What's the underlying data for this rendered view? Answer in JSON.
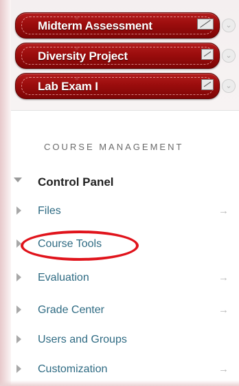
{
  "content_buttons": [
    {
      "label": "Midterm Assessment",
      "icon": "test-icon",
      "menu_icon": "chevron-down-icon"
    },
    {
      "label": "Diversity Project",
      "icon": "unavailable-icon",
      "menu_icon": "chevron-down-icon"
    },
    {
      "label": "Lab Exam I",
      "icon": "unavailable-icon",
      "menu_icon": "chevron-down-icon"
    }
  ],
  "course_management": {
    "section_title": "COURSE MANAGEMENT",
    "control_panel": {
      "label": "Control Panel",
      "icon": "triangle-down-icon"
    },
    "items": [
      {
        "label": "Files",
        "arrow": "→"
      },
      {
        "label": "Course Tools",
        "arrow": ""
      },
      {
        "label": "Evaluation",
        "arrow": "→"
      },
      {
        "label": "Grade Center",
        "arrow": "→"
      },
      {
        "label": "Users and Groups",
        "arrow": ""
      },
      {
        "label": "Customization",
        "arrow": "→"
      }
    ]
  },
  "colors": {
    "button_red": "#9b0d0d",
    "link_blue": "#2f6b83",
    "highlight_red": "#e0131b"
  }
}
